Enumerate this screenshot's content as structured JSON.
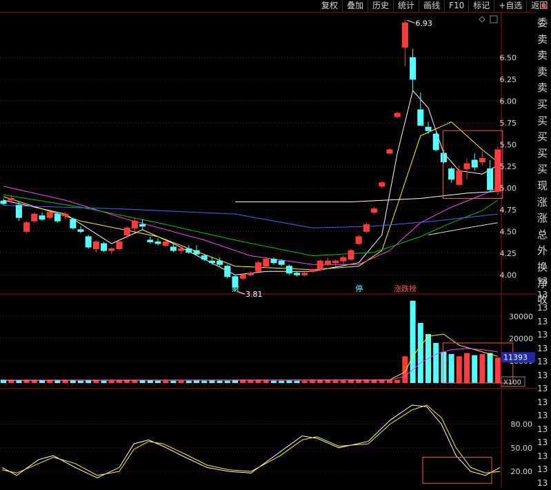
{
  "toolbar": {
    "items": [
      "复权",
      "叠加",
      "历史",
      "统计",
      "画线",
      "F10",
      "标记",
      "+自选",
      "返回"
    ],
    "corner": "L"
  },
  "side_panel": {
    "labels": [
      "委",
      "卖",
      "卖",
      "卖",
      "卖",
      "买",
      "买",
      "买",
      "买",
      "买",
      "现",
      "涨",
      "涨",
      "总",
      "外",
      "换",
      "净",
      "收"
    ],
    "values": [
      "13",
      "13",
      "13",
      "13",
      "13",
      "13",
      "13",
      "13",
      "13",
      "13",
      "13",
      "13",
      "13",
      "13",
      "13",
      "13"
    ]
  },
  "colors": {
    "up": "#ff3b3b",
    "down": "#54ffff",
    "ma5": "#ffffff",
    "ma10": "#ffff00",
    "ma20": "#ff44ff",
    "ma30": "#00cc00",
    "ma60": "#4466ff",
    "highlight": "#ff5555"
  },
  "chart_data": [
    {
      "type": "candlestick",
      "panel": "price",
      "ylim": [
        3.78,
        7.02
      ],
      "y_ticks": [
        "6.50",
        "6.25",
        "6.00",
        "5.75",
        "5.50",
        "5.25",
        "5.00",
        "4.75",
        "4.50",
        "4.25",
        "4.00"
      ],
      "high_label": "6.93",
      "low_label": "3.81",
      "markers": [
        "财",
        "停",
        "涨跌榜"
      ],
      "candles": [
        [
          4.85,
          4.88,
          4.8,
          4.82
        ],
        [
          4.86,
          4.92,
          4.82,
          4.88
        ],
        [
          4.8,
          4.84,
          4.62,
          4.66
        ],
        [
          4.5,
          4.62,
          4.48,
          4.6
        ],
        [
          4.62,
          4.72,
          4.6,
          4.7
        ],
        [
          4.68,
          4.72,
          4.62,
          4.64
        ],
        [
          4.66,
          4.74,
          4.64,
          4.72
        ],
        [
          4.7,
          4.72,
          4.6,
          4.62
        ],
        [
          4.68,
          4.72,
          4.64,
          4.7
        ],
        [
          4.64,
          4.66,
          4.52,
          4.54
        ],
        [
          4.52,
          4.56,
          4.48,
          4.5
        ],
        [
          4.44,
          4.46,
          4.3,
          4.32
        ],
        [
          4.3,
          4.4,
          4.26,
          4.38
        ],
        [
          4.36,
          4.38,
          4.26,
          4.28
        ],
        [
          4.28,
          4.32,
          4.24,
          4.3
        ],
        [
          4.3,
          4.4,
          4.28,
          4.38
        ],
        [
          4.46,
          4.56,
          4.42,
          4.54
        ],
        [
          4.54,
          4.66,
          4.5,
          4.62
        ],
        [
          4.58,
          4.64,
          4.52,
          4.56
        ],
        [
          4.4,
          4.44,
          4.36,
          4.38
        ],
        [
          4.38,
          4.42,
          4.34,
          4.36
        ],
        [
          4.34,
          4.4,
          4.32,
          4.38
        ],
        [
          4.32,
          4.36,
          4.26,
          4.28
        ],
        [
          4.28,
          4.32,
          4.24,
          4.3
        ],
        [
          4.3,
          4.34,
          4.24,
          4.26
        ],
        [
          4.28,
          4.34,
          4.22,
          4.24
        ],
        [
          4.22,
          4.24,
          4.16,
          4.18
        ],
        [
          4.16,
          4.2,
          4.12,
          4.14
        ],
        [
          4.16,
          4.2,
          4.1,
          4.12
        ],
        [
          4.1,
          4.12,
          3.96,
          3.98
        ],
        [
          3.98,
          4.0,
          3.81,
          3.86
        ],
        [
          3.96,
          4.02,
          3.94,
          4.0
        ],
        [
          4.0,
          4.04,
          3.98,
          4.02
        ],
        [
          4.04,
          4.16,
          4.02,
          4.14
        ],
        [
          4.1,
          4.2,
          4.08,
          4.18
        ],
        [
          4.18,
          4.2,
          4.12,
          4.14
        ],
        [
          4.16,
          4.18,
          4.1,
          4.12
        ],
        [
          4.1,
          4.12,
          4.0,
          4.02
        ],
        [
          4.02,
          4.04,
          3.98,
          4.0
        ],
        [
          4.0,
          4.04,
          3.98,
          4.02
        ],
        [
          4.04,
          4.08,
          4.02,
          4.06
        ],
        [
          4.06,
          4.18,
          4.04,
          4.16
        ],
        [
          4.12,
          4.2,
          4.1,
          4.16
        ],
        [
          4.14,
          4.18,
          4.1,
          4.16
        ],
        [
          4.16,
          4.22,
          4.12,
          4.2
        ],
        [
          4.18,
          4.3,
          4.16,
          4.28
        ],
        [
          4.36,
          4.46,
          4.34,
          4.44
        ],
        [
          4.5,
          4.6,
          4.48,
          4.58
        ],
        [
          4.72,
          4.78,
          4.7,
          4.76
        ],
        [
          5.02,
          5.08,
          5.0,
          5.06
        ],
        [
          5.4,
          5.46,
          5.38,
          5.44
        ],
        [
          5.82,
          5.88,
          5.8,
          5.86
        ],
        [
          6.62,
          6.93,
          6.4,
          6.9
        ],
        [
          6.5,
          6.6,
          6.12,
          6.25
        ],
        [
          5.9,
          6.1,
          5.74,
          5.72
        ],
        [
          5.7,
          5.76,
          5.62,
          5.66
        ],
        [
          5.62,
          5.64,
          5.42,
          5.44
        ],
        [
          5.4,
          5.44,
          5.28,
          5.3
        ],
        [
          5.22,
          5.24,
          5.06,
          5.1
        ],
        [
          5.04,
          5.26,
          5.02,
          5.2
        ],
        [
          5.22,
          5.34,
          5.1,
          5.28
        ],
        [
          5.32,
          5.4,
          5.2,
          5.24
        ],
        [
          5.3,
          5.42,
          5.26,
          5.34
        ],
        [
          5.22,
          5.32,
          4.96,
          4.98
        ],
        [
          4.96,
          5.48,
          4.92,
          5.44
        ]
      ],
      "ma_series": [
        {
          "key": "ma5",
          "values": [
            [
              0,
              4.86
            ],
            [
              8,
              4.7
            ],
            [
              14,
              4.36
            ],
            [
              18,
              4.52
            ],
            [
              22,
              4.36
            ],
            [
              30,
              4.0
            ],
            [
              34,
              4.04
            ],
            [
              40,
              4.04
            ],
            [
              46,
              4.14
            ],
            [
              49,
              4.46
            ],
            [
              51,
              5.4
            ],
            [
              53,
              6.12
            ],
            [
              55,
              5.92
            ],
            [
              57,
              5.4
            ],
            [
              59,
              5.2
            ],
            [
              62,
              5.16
            ],
            [
              64,
              5.26
            ]
          ]
        },
        {
          "key": "ma10",
          "values": [
            [
              0,
              4.9
            ],
            [
              10,
              4.62
            ],
            [
              20,
              4.44
            ],
            [
              30,
              4.1
            ],
            [
              40,
              4.06
            ],
            [
              46,
              4.1
            ],
            [
              49,
              4.28
            ],
            [
              51,
              4.8
            ],
            [
              54,
              5.6
            ],
            [
              58,
              5.76
            ],
            [
              60,
              5.6
            ],
            [
              62,
              5.44
            ],
            [
              64,
              5.3
            ]
          ]
        },
        {
          "key": "ma20",
          "values": [
            [
              0,
              5.02
            ],
            [
              8,
              4.86
            ],
            [
              16,
              4.64
            ],
            [
              26,
              4.4
            ],
            [
              32,
              4.22
            ],
            [
              40,
              4.12
            ],
            [
              46,
              4.12
            ],
            [
              50,
              4.28
            ],
            [
              54,
              4.6
            ],
            [
              58,
              4.78
            ],
            [
              62,
              4.92
            ],
            [
              64,
              5.0
            ]
          ]
        },
        {
          "key": "ma30",
          "values": [
            [
              0,
              4.92
            ],
            [
              10,
              4.78
            ],
            [
              20,
              4.6
            ],
            [
              30,
              4.4
            ],
            [
              40,
              4.22
            ],
            [
              48,
              4.26
            ],
            [
              54,
              4.44
            ],
            [
              58,
              4.6
            ],
            [
              62,
              4.74
            ],
            [
              64,
              4.86
            ]
          ]
        },
        {
          "key": "ma60",
          "values": [
            [
              0,
              4.8
            ],
            [
              15,
              4.76
            ],
            [
              30,
              4.7
            ],
            [
              40,
              4.54
            ],
            [
              48,
              4.56
            ],
            [
              56,
              4.62
            ],
            [
              64,
              4.7
            ]
          ]
        },
        {
          "key": "ma120",
          "values": [
            [
              55,
              4.46
            ],
            [
              60,
              4.54
            ],
            [
              64,
              4.6
            ]
          ]
        },
        {
          "key": "ma250",
          "values": [
            [
              30,
              4.84
            ],
            [
              45,
              4.84
            ],
            [
              54,
              4.88
            ],
            [
              60,
              4.94
            ],
            [
              64,
              4.96
            ]
          ]
        }
      ]
    },
    {
      "type": "bar",
      "panel": "volume",
      "ylim": [
        0,
        40000
      ],
      "y_ticks": [
        "30000",
        "20000",
        "10000"
      ],
      "current_value_label": "11393",
      "unit_label": "X100",
      "values": [
        1500,
        1400,
        1300,
        1200,
        1200,
        1100,
        1200,
        1100,
        1200,
        1100,
        1000,
        1100,
        1100,
        1000,
        1000,
        1100,
        1300,
        1400,
        1200,
        1100,
        1000,
        1000,
        1000,
        1000,
        1000,
        1100,
        1000,
        1100,
        1000,
        1000,
        1400,
        1200,
        1100,
        1200,
        1100,
        1000,
        1000,
        1100,
        1000,
        1000,
        1100,
        1200,
        1300,
        1100,
        1100,
        1300,
        1500,
        1600,
        1500,
        1600,
        1300,
        1400,
        12000,
        37000,
        27000,
        22000,
        18000,
        14000,
        13000,
        12000,
        13500,
        12500,
        13000,
        13500,
        11393
      ],
      "ma_series": [
        {
          "key": "vma5",
          "values": [
            [
              0,
              1200
            ],
            [
              50,
              1400
            ],
            [
              52,
              5000
            ],
            [
              53,
              12000
            ],
            [
              55,
              21000
            ],
            [
              57,
              22000
            ],
            [
              59,
              17000
            ],
            [
              61,
              15000
            ],
            [
              63,
              13000
            ],
            [
              64,
              12000
            ]
          ]
        },
        {
          "key": "vma10",
          "values": [
            [
              0,
              1300
            ],
            [
              50,
              1300
            ],
            [
              52,
              3000
            ],
            [
              54,
              9000
            ],
            [
              56,
              13000
            ],
            [
              58,
              15000
            ],
            [
              60,
              15500
            ],
            [
              62,
              15000
            ],
            [
              64,
              14000
            ]
          ]
        }
      ]
    },
    {
      "type": "line",
      "panel": "oscillator",
      "ylim": [
        0,
        125
      ],
      "y_ticks": [
        "80.00",
        "50.00",
        "20.00"
      ],
      "series": [
        {
          "key": "k",
          "values": [
            [
              0,
              25
            ],
            [
              2,
              15
            ],
            [
              5,
              35
            ],
            [
              7,
              40
            ],
            [
              10,
              25
            ],
            [
              13,
              12
            ],
            [
              16,
              25
            ],
            [
              18,
              55
            ],
            [
              20,
              60
            ],
            [
              22,
              52
            ],
            [
              25,
              38
            ],
            [
              28,
              25
            ],
            [
              31,
              20
            ],
            [
              34,
              18
            ],
            [
              38,
              45
            ],
            [
              41,
              65
            ],
            [
              43,
              62
            ],
            [
              46,
              50
            ],
            [
              50,
              58
            ],
            [
              53,
              85
            ],
            [
              56,
              104
            ],
            [
              58,
              102
            ],
            [
              60,
              80
            ],
            [
              62,
              40
            ],
            [
              64,
              20
            ],
            [
              66,
              15
            ],
            [
              68,
              25
            ]
          ]
        },
        {
          "key": "d",
          "values": [
            [
              0,
              22
            ],
            [
              2,
              18
            ],
            [
              5,
              30
            ],
            [
              7,
              38
            ],
            [
              10,
              30
            ],
            [
              13,
              15
            ],
            [
              16,
              20
            ],
            [
              18,
              48
            ],
            [
              20,
              58
            ],
            [
              22,
              55
            ],
            [
              25,
              42
            ],
            [
              28,
              28
            ],
            [
              31,
              22
            ],
            [
              34,
              20
            ],
            [
              38,
              40
            ],
            [
              41,
              60
            ],
            [
              43,
              64
            ],
            [
              46,
              52
            ],
            [
              50,
              55
            ],
            [
              53,
              80
            ],
            [
              56,
              98
            ],
            [
              58,
              104
            ],
            [
              60,
              88
            ],
            [
              62,
              50
            ],
            [
              64,
              25
            ],
            [
              66,
              18
            ],
            [
              68,
              20
            ]
          ]
        }
      ]
    }
  ]
}
